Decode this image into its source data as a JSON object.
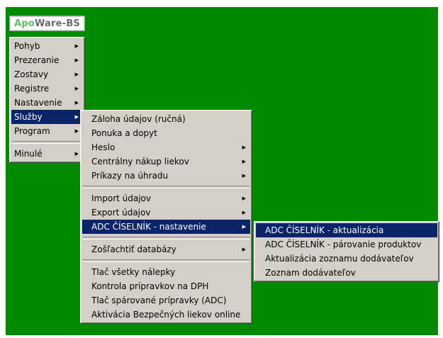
{
  "logo": {
    "part1": "Apo",
    "part2": "Ware-BS"
  },
  "main_menu": {
    "pohyb": "Pohyb",
    "prezeranie": "Prezeranie",
    "zostavy": "Zostavy",
    "registre": "Registre",
    "nastavenie": "Nastavenie",
    "sluzby": "Služby",
    "program": "Program",
    "minule": "Minulé"
  },
  "sluzby_menu": {
    "zaloha": "Záloha údajov (ručná)",
    "ponuka": "Ponuka a dopyt",
    "heslo": "Heslo",
    "centralny": "Centrálny nákup liekov",
    "prikazy": "Príkazy na úhradu",
    "import": "Import údajov",
    "export": "Export údajov",
    "adc_nastavenie": "ADC ČÍSELNÍK - nastavenie",
    "zoslachtit": "Zošľachtiť databázy",
    "tlac_nalepky": "Tlač všetky nálepky",
    "kontrola_dph": "Kontrola prípravkov na DPH",
    "tlac_sparovane": "Tlač spárované prípravky (ADC)",
    "aktivacia": "Aktivácia Bezpečných liekov online"
  },
  "adc_menu": {
    "aktualizacia": "ADC ČÍSELNÍK - aktualizácia",
    "parovanie": "ADC ČÍSELNÍK - párovanie produktov",
    "aktualizacia_dodavatelov": "Aktualizácia zoznamu dodávateľov",
    "zoznam_dodavatelov": "Zoznam dodávateľov"
  },
  "icons": {
    "submenu_arrow": "▶"
  },
  "colors": {
    "desktop": "#008a00",
    "menu_bg": "#d4d0c8",
    "highlight": "#0a246a"
  }
}
